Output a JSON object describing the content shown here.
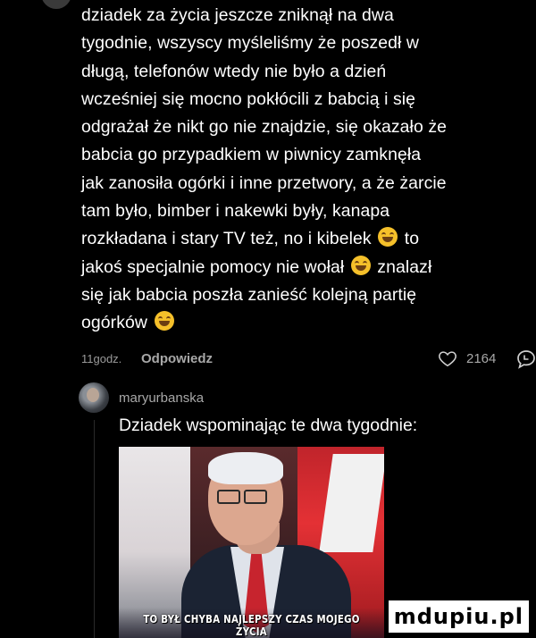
{
  "comment": {
    "lines": [
      "dziadek za życia jeszcze zniknął na dwa",
      "tygodnie, wszyscy myśleliśmy że poszedł w",
      "długą, telefonów wtedy nie było a dzień",
      "wcześniej się mocno pokłócili z babcią i się",
      "odgrażał że nikt go nie znajdzie, się okazało że",
      "babcia go przypadkiem w piwnicy zamknęła",
      "jak zanosiła ogórki i inne przetwory, a że żarcie",
      "tam było, bimber i nakewki były, kanapa",
      "rozkładana i stary TV też, no i kibelek",
      " to",
      "jakoś specjalnie pomocy nie wołał",
      " znalazł",
      "się jak babcia poszła zanieść kolejną partię",
      "ogórków"
    ],
    "time": "11godz.",
    "reply_label": "Odpowiedz",
    "likes": "2164"
  },
  "reply": {
    "username": "maryurbanska",
    "text": "Dziadek wspominając te dwa tygodnie:",
    "photo_caption": "TO BYŁ CHYBA NAJLEPSZY CZAS MOJEGO ŻYCIA"
  },
  "watermark": "mdupiu.pl",
  "colors": {
    "background": "#000000",
    "text": "#ffffff",
    "muted": "#a8a8a8",
    "emoji": "#f5c02a"
  }
}
